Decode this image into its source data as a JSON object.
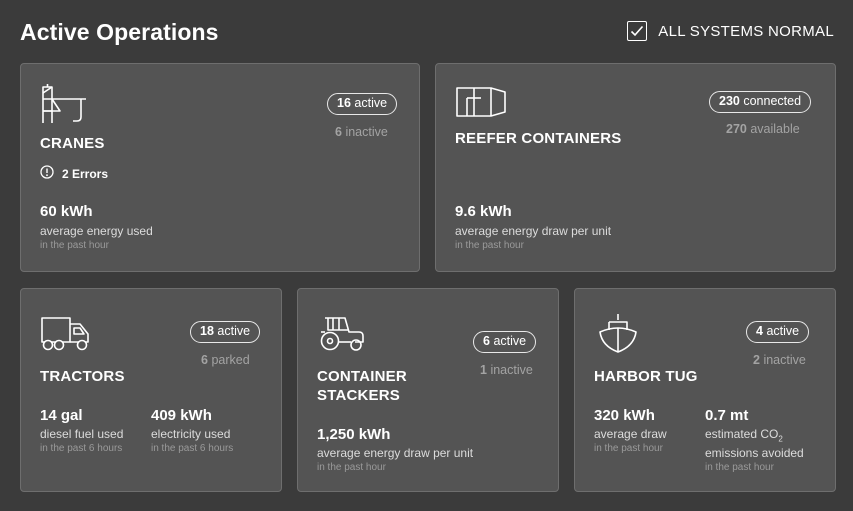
{
  "header": {
    "title": "Active Operations",
    "status_label": "ALL SYSTEMS NORMAL",
    "status_icon": "checkbox-checked-icon"
  },
  "cards": {
    "cranes": {
      "icon": "crane-icon",
      "title": "CRANES",
      "active_count": "16",
      "active_label": "active",
      "inactive_count": "6",
      "inactive_label": "inactive",
      "errors_icon": "alert-circle-icon",
      "errors_label": "2 Errors",
      "metric_value": "60 kWh",
      "metric_desc": "average energy used",
      "metric_period": "in the past hour"
    },
    "reefer": {
      "icon": "container-icon",
      "title": "REEFER CONTAINERS",
      "connected_count": "230",
      "connected_label": "connected",
      "available_count": "270",
      "available_label": "available",
      "metric_value": "9.6 kWh",
      "metric_desc": "average energy draw per unit",
      "metric_period": "in the past hour"
    },
    "tractors": {
      "icon": "truck-icon",
      "title": "TRACTORS",
      "active_count": "18",
      "active_label": "active",
      "parked_count": "6",
      "parked_label": "parked",
      "metric1_value": "14 gal",
      "metric1_desc": "diesel fuel used",
      "metric1_period": "in the past 6 hours",
      "metric2_value": "409 kWh",
      "metric2_desc": "electricity used",
      "metric2_period": "in the past 6 hours"
    },
    "stackers": {
      "icon": "tractor-icon",
      "title_line1": "CONTAINER",
      "title_line2": "STACKERS",
      "active_count": "6",
      "active_label": "active",
      "inactive_count": "1",
      "inactive_label": "inactive",
      "metric_value": "1,250 kWh",
      "metric_desc": "average energy draw per unit",
      "metric_period": "in the past hour"
    },
    "tug": {
      "icon": "boat-icon",
      "title": "HARBOR TUG",
      "active_count": "4",
      "active_label": "active",
      "inactive_count": "2",
      "inactive_label": "inactive",
      "metric1_value": "320 kWh",
      "metric1_desc": "average draw",
      "metric1_period": "in the past hour",
      "metric2_value": "0.7 mt",
      "metric2_desc_line1": "estimated CO",
      "metric2_desc_sub": "2",
      "metric2_desc_line2": "emissions avoided",
      "metric2_period": "in the past hour"
    }
  }
}
